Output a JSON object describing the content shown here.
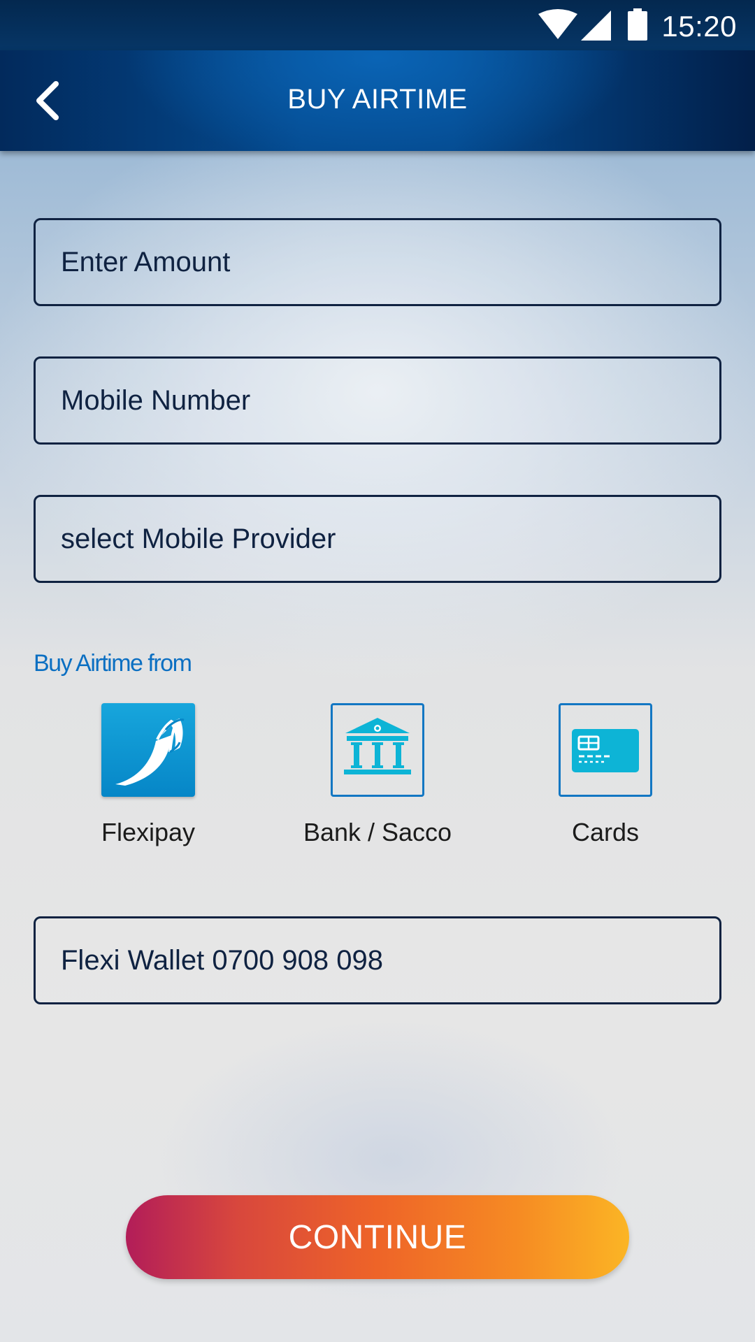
{
  "status_bar": {
    "time": "15:20",
    "icons": [
      "wifi-icon",
      "signal-icon",
      "battery-icon"
    ]
  },
  "header": {
    "title": "BUY AIRTIME",
    "back_icon": "chevron-left-icon"
  },
  "form": {
    "amount": {
      "placeholder": "Enter Amount",
      "value": ""
    },
    "mobile_number": {
      "placeholder": "Mobile Number",
      "value": ""
    },
    "provider": {
      "selected": "select Mobile Provider"
    }
  },
  "sources": {
    "label": "Buy Airtime from",
    "options": [
      {
        "label": "Flexipay",
        "icon": "flexipay-icon",
        "selected": true
      },
      {
        "label": "Bank / Sacco",
        "icon": "bank-icon",
        "selected": false
      },
      {
        "label": "Cards",
        "icon": "card-icon",
        "selected": false
      }
    ]
  },
  "wallet": {
    "selected": "Flexi Wallet 0700 908 098"
  },
  "actions": {
    "continue_label": "CONTINUE"
  },
  "colors": {
    "header": "#044a8f",
    "field_border": "#0f2241",
    "accent_blue": "#0b6fc2",
    "icon_teal": "#0db4d6",
    "button_gradient_start": "#b21d59",
    "button_gradient_end": "#fbb525"
  }
}
